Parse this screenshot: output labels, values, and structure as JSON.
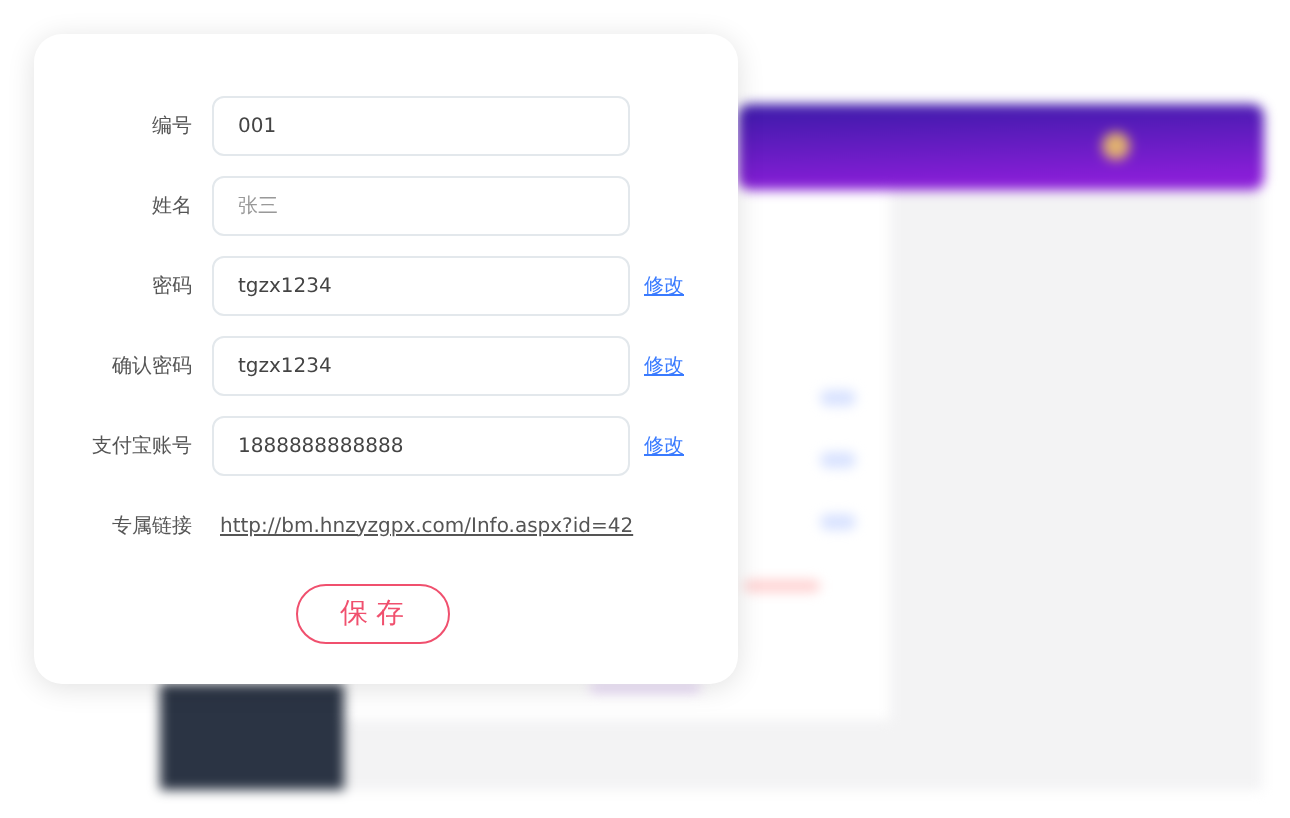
{
  "form": {
    "rows": [
      {
        "kind": "input",
        "label": "编号",
        "value": "001"
      },
      {
        "kind": "input",
        "label": "姓名",
        "placeholder": "张三"
      },
      {
        "kind": "input",
        "label": "密码",
        "value": "tgzx1234",
        "action": "修改"
      },
      {
        "kind": "input",
        "label": "确认密码",
        "value": "tgzx1234",
        "action": "修改"
      },
      {
        "kind": "input",
        "label": "支付宝账号",
        "value": "1888888888888",
        "action": "修改"
      },
      {
        "kind": "link",
        "label": "专属链接",
        "value": "http://bm.hnzyzgpx.com/Info.aspx?id=42"
      }
    ],
    "save_button": "保 存"
  }
}
